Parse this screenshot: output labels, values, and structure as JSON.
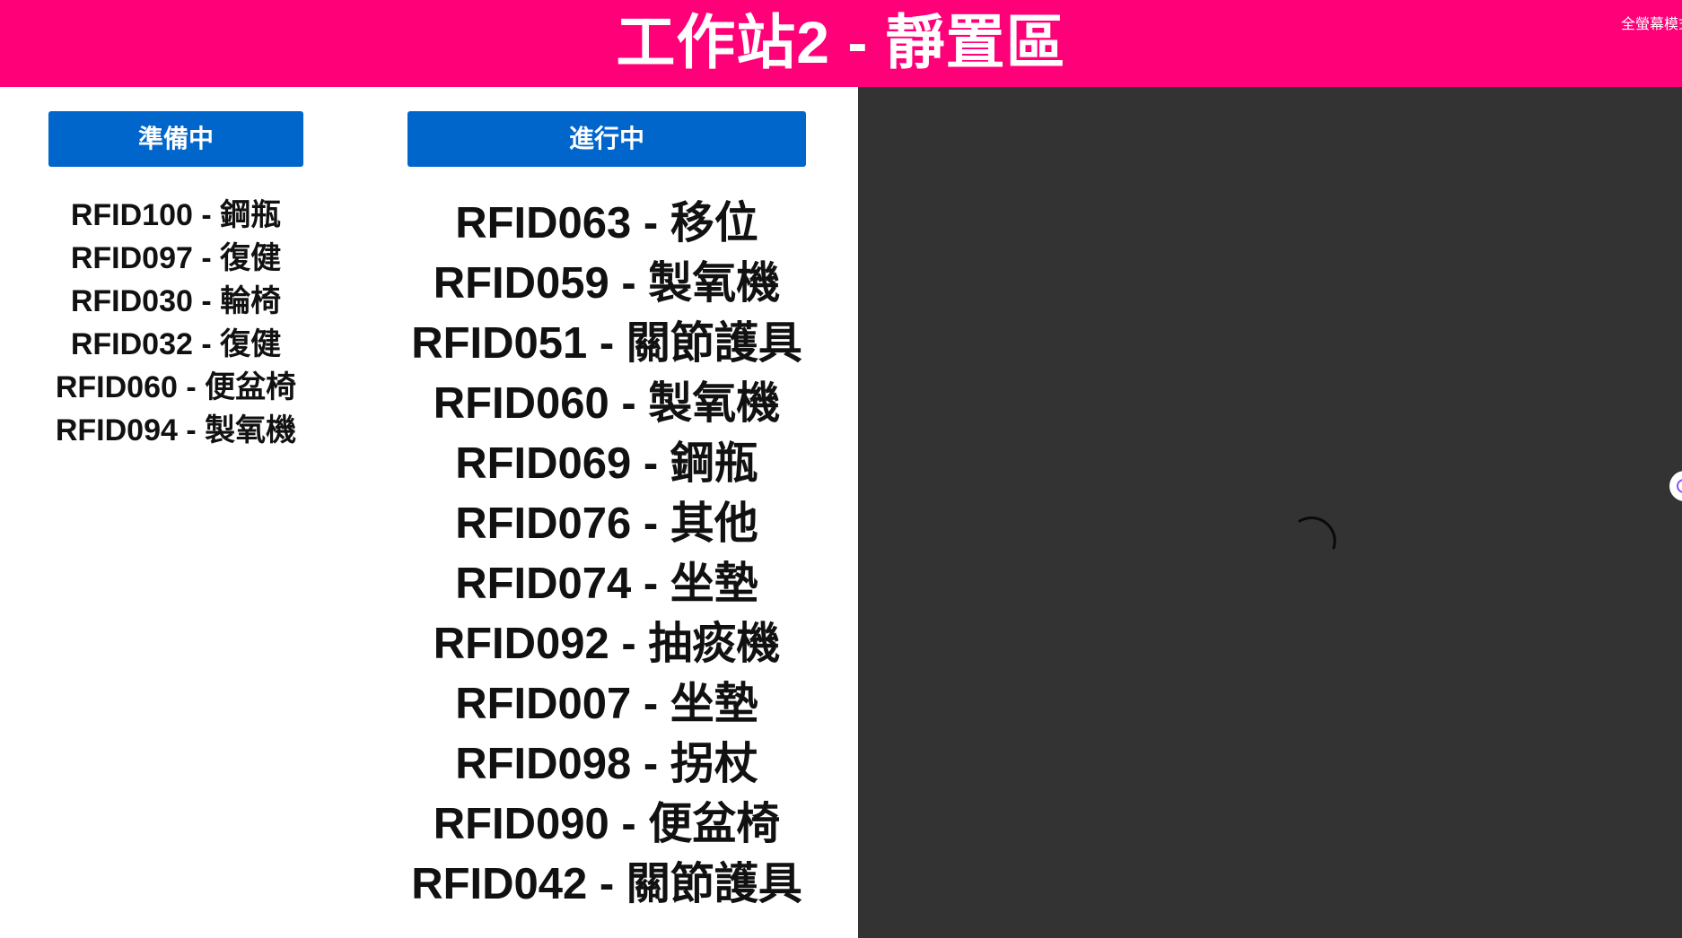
{
  "header": {
    "title": "工作站2 - 靜置區",
    "fullscreen_label": "全螢幕模式"
  },
  "columns": {
    "ready": {
      "label": "準備中",
      "items": [
        "RFID100 - 鋼瓶",
        "RFID097 - 復健",
        "RFID030 - 輪椅",
        "RFID032 - 復健",
        "RFID060 - 便盆椅",
        "RFID094 - 製氧機"
      ]
    },
    "in_progress": {
      "label": "進行中",
      "items": [
        "RFID063 - 移位",
        "RFID059 - 製氧機",
        "RFID051 - 關節護具",
        "RFID060 - 製氧機",
        "RFID069 - 鋼瓶",
        "RFID076 - 其他",
        "RFID074 - 坐墊",
        "RFID092 - 抽痰機",
        "RFID007 - 坐墊",
        "RFID098 - 拐杖",
        "RFID090 - 便盆椅",
        "RFID042 - 關節護具"
      ]
    }
  },
  "icons": {
    "loading": "loading-spinner-icon",
    "side_handle": "side-panel-handle-icon"
  },
  "colors": {
    "header_bg": "#ff0078",
    "column_header_bg": "#0066cc",
    "video_bg": "#333333"
  }
}
